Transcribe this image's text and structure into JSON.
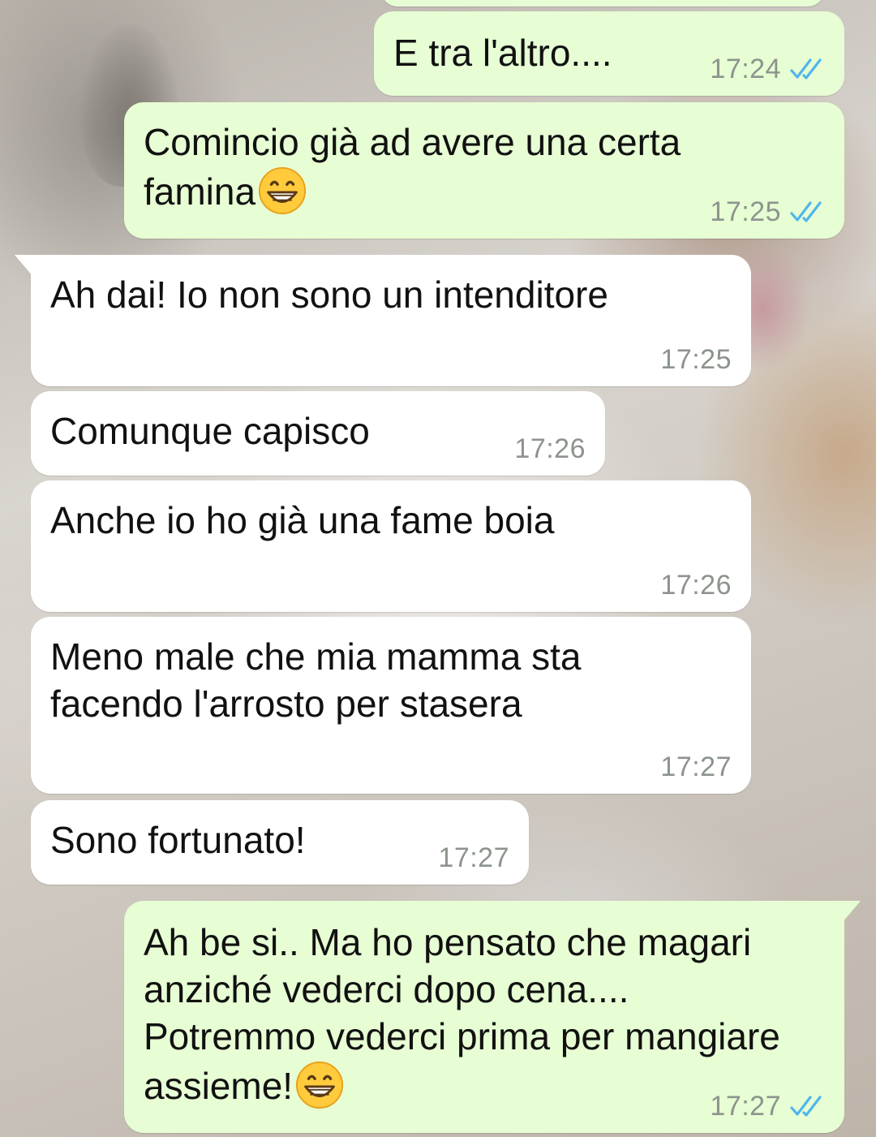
{
  "colors": {
    "outgoing_bubble": "#e7fdd4",
    "incoming_bubble": "#ffffff",
    "timestamp": "#8c948c",
    "read_ticks": "#4fb6ec"
  },
  "messages": [
    {
      "direction": "outgoing",
      "text": "E tra l'altro....",
      "time": "17:24",
      "status": "read",
      "status_icon": "double-check-icon"
    },
    {
      "direction": "outgoing",
      "text_before_emoji": "Comincio già ad avere una certa\nfamina",
      "emoji": "grinning-face-with-smiling-eyes",
      "time": "17:25",
      "status": "read",
      "status_icon": "double-check-icon"
    },
    {
      "direction": "incoming",
      "text": "Ah dai! Io non sono un intenditore",
      "time": "17:25"
    },
    {
      "direction": "incoming",
      "text": "Comunque capisco",
      "time": "17:26"
    },
    {
      "direction": "incoming",
      "text": "Anche io ho già una fame boia",
      "time": "17:26"
    },
    {
      "direction": "incoming",
      "text": "Meno male che mia mamma sta\nfacendo l'arrosto per stasera",
      "time": "17:27"
    },
    {
      "direction": "incoming",
      "text": "Sono fortunato!",
      "time": "17:27"
    },
    {
      "direction": "outgoing",
      "text_before_emoji": "Ah be si.. Ma ho pensato che magari\nanziché vederci dopo cena....\nPotremmo vederci prima per mangiare\nassieme!",
      "emoji": "grinning-face-with-smiling-eyes",
      "time": "17:27",
      "status": "read",
      "status_icon": "double-check-icon"
    }
  ]
}
